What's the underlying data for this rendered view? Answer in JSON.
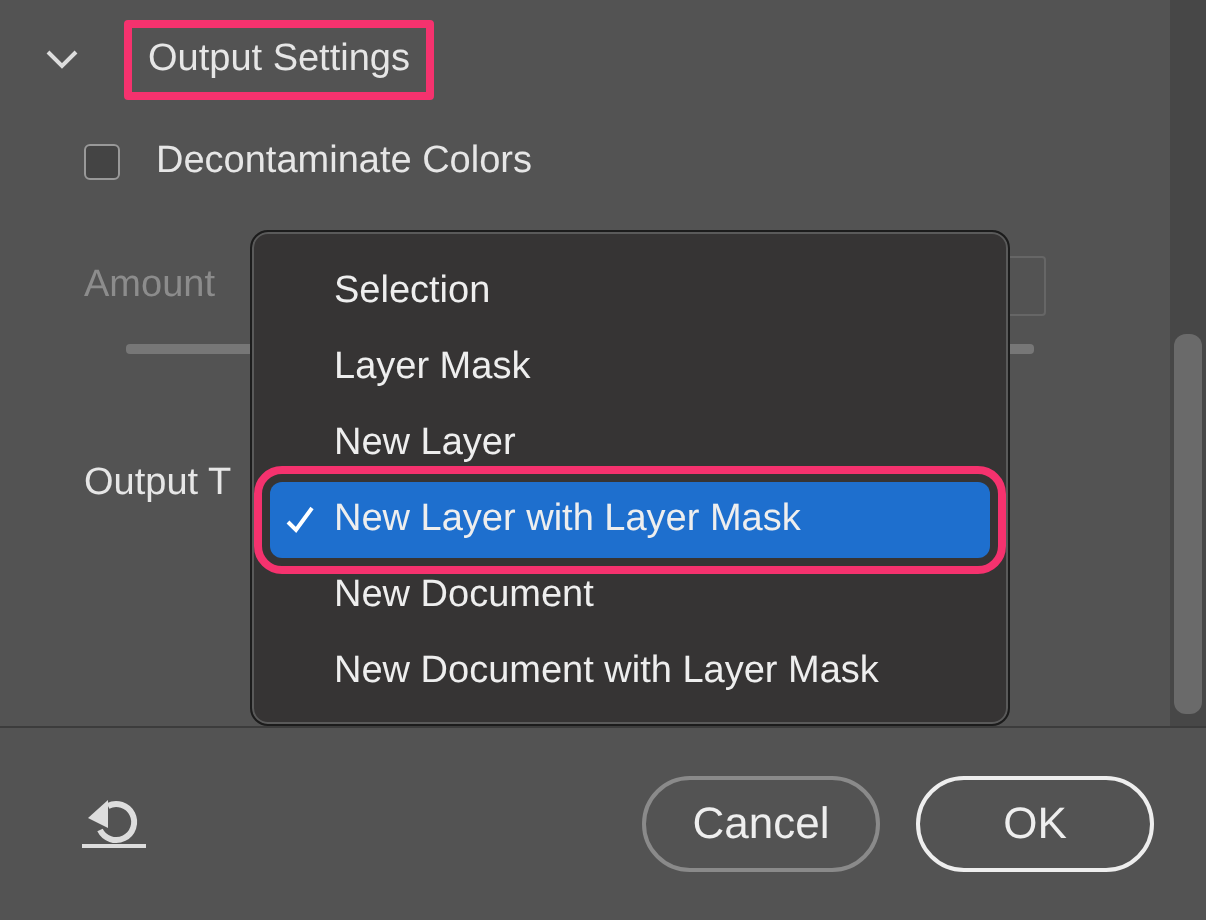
{
  "section": {
    "title": "Output Settings",
    "expanded": true,
    "highlighted": true
  },
  "decontaminate": {
    "label": "Decontaminate Colors",
    "checked": false
  },
  "amount": {
    "label": "Amount",
    "disabled": true
  },
  "output_to": {
    "label": "Output T"
  },
  "menu": {
    "items": [
      {
        "label": "Selection",
        "selected": false,
        "highlighted": false
      },
      {
        "label": "Layer Mask",
        "selected": false,
        "highlighted": false
      },
      {
        "label": "New Layer",
        "selected": false,
        "highlighted": false
      },
      {
        "label": "New Layer with Layer Mask",
        "selected": true,
        "highlighted": true
      },
      {
        "label": "New Document",
        "selected": false,
        "highlighted": false
      },
      {
        "label": "New Document with Layer Mask",
        "selected": false,
        "highlighted": false
      }
    ]
  },
  "buttons": [
    {
      "label": "Cancel",
      "kind": "secondary"
    },
    {
      "label": "OK",
      "kind": "default"
    }
  ]
}
